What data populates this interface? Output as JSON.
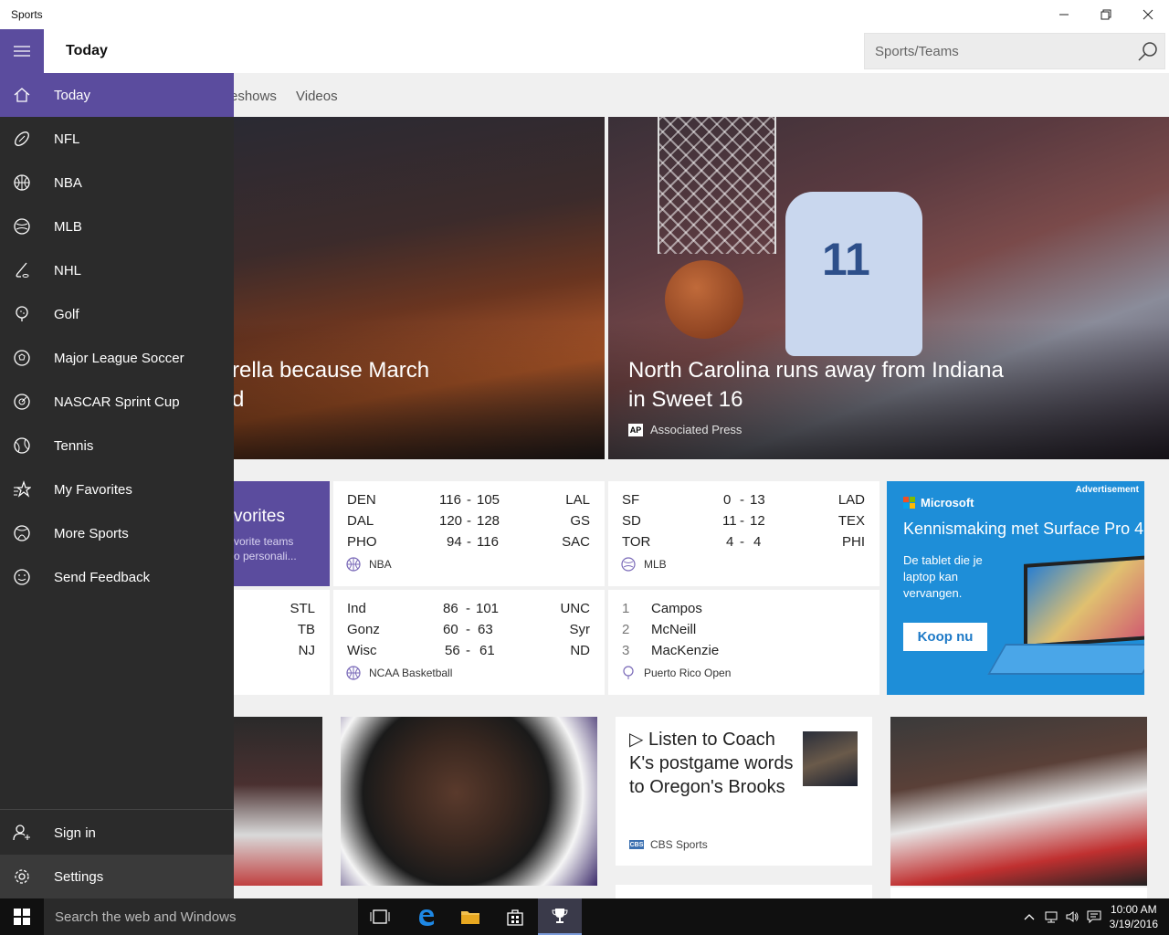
{
  "window": {
    "title": "Sports"
  },
  "header": {
    "page_title": "Today",
    "search_placeholder": "Sports/Teams"
  },
  "tabs": [
    {
      "label": "eshows"
    },
    {
      "label": "Videos"
    }
  ],
  "nav": {
    "items": [
      {
        "label": "Today",
        "icon": "home-icon"
      },
      {
        "label": "NFL",
        "icon": "football-icon"
      },
      {
        "label": "NBA",
        "icon": "basketball-icon"
      },
      {
        "label": "MLB",
        "icon": "baseball-icon"
      },
      {
        "label": "NHL",
        "icon": "hockey-icon"
      },
      {
        "label": "Golf",
        "icon": "golf-icon"
      },
      {
        "label": "Major League Soccer",
        "icon": "soccer-icon"
      },
      {
        "label": "NASCAR Sprint Cup",
        "icon": "racing-icon"
      },
      {
        "label": "Tennis",
        "icon": "tennis-icon"
      },
      {
        "label": "My Favorites",
        "icon": "favorites-star-icon"
      },
      {
        "label": "More Sports",
        "icon": "more-sports-icon"
      },
      {
        "label": "Send Feedback",
        "icon": "smiley-icon"
      }
    ],
    "bottom": [
      {
        "label": "Sign in",
        "icon": "person-add-icon"
      },
      {
        "label": "Settings",
        "icon": "gear-icon"
      }
    ]
  },
  "hero": {
    "left_title_line1": "rella because March",
    "left_title_line2": "d",
    "right_title_line1": "North Carolina runs away from Indiana",
    "right_title_line2": "in Sweet 16",
    "right_source": "Associated Press",
    "right_source_logo": "AP",
    "jersey_text": "11"
  },
  "favorites_card": {
    "title": "vorites",
    "sub_line1": "vorite teams",
    "sub_line2": "o personali..."
  },
  "partial_card": {
    "codes": [
      "STL",
      "TB",
      "NJ"
    ]
  },
  "nba_card": {
    "rows": [
      {
        "home": "DEN",
        "s1": "116",
        "sep": "-",
        "s2": "105",
        "away": "LAL"
      },
      {
        "home": "DAL",
        "s1": "120",
        "sep": "-",
        "s2": "128",
        "away": "GS"
      },
      {
        "home": "PHO",
        "s1": "94",
        "sep": "-",
        "s2": "116",
        "away": "SAC"
      }
    ],
    "league": "NBA"
  },
  "mlb_card": {
    "rows": [
      {
        "home": "SF",
        "s1": "0",
        "sep": "-",
        "s2": "13",
        "away": "LAD"
      },
      {
        "home": "SD",
        "s1": "11",
        "sep": "-",
        "s2": "12",
        "away": "TEX"
      },
      {
        "home": "TOR",
        "s1": "4",
        "sep": "-",
        "s2": "4",
        "away": "PHI"
      }
    ],
    "league": "MLB"
  },
  "ncaa_card": {
    "rows": [
      {
        "home": "Ind",
        "s1": "86",
        "sep": "-",
        "s2": "101",
        "away": "UNC"
      },
      {
        "home": "Gonz",
        "s1": "60",
        "sep": "-",
        "s2": "63",
        "away": "Syr"
      },
      {
        "home": "Wisc",
        "s1": "56",
        "sep": "-",
        "s2": "61",
        "away": "ND"
      }
    ],
    "league": "NCAA Basketball"
  },
  "golf_card": {
    "rows": [
      {
        "rank": "1",
        "name": "Campos"
      },
      {
        "rank": "2",
        "name": "McNeill"
      },
      {
        "rank": "3",
        "name": "MacKenzie"
      }
    ],
    "event": "Puerto Rico Open"
  },
  "ad": {
    "label": "Advertisement",
    "brand": "Microsoft",
    "headline": "Kennismaking met Surface Pro 4",
    "text": "De tablet die je laptop kan vervangen.",
    "button": "Koop nu",
    "colors": {
      "background": "#1e8ed8",
      "ms_red": "#f25022",
      "ms_green": "#7fba00",
      "ms_blue": "#00a4ef",
      "ms_yellow": "#ffb900"
    }
  },
  "video_card": {
    "play_glyph": "▷",
    "title": "Listen to Coach K's postgame words to Oregon's Brooks",
    "source": "CBS Sports",
    "source_logo": "CBS"
  },
  "taskbar": {
    "search_placeholder": "Search the web and Windows",
    "time": "10:00 AM",
    "date": "3/19/2016"
  },
  "colors": {
    "accent": "#5b4c9e",
    "nav_bg": "#2b2b2b",
    "taskbar_bg": "#101010"
  }
}
